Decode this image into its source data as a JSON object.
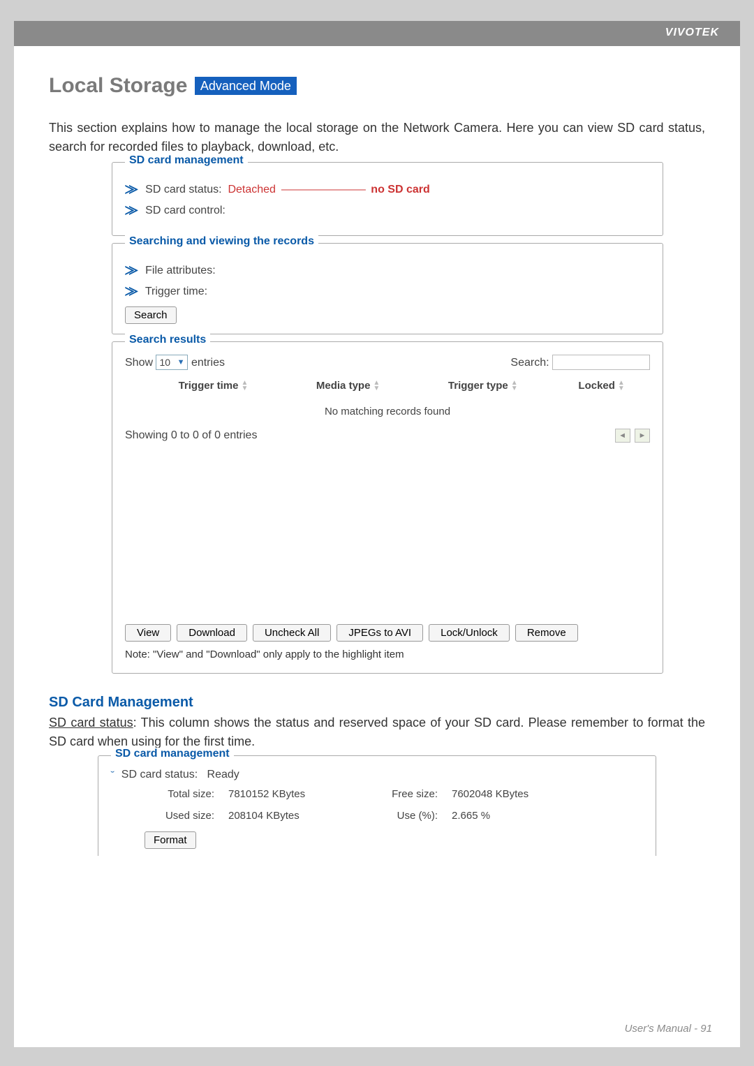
{
  "brand": "VIVOTEK",
  "page_title": "Local Storage",
  "badge": "Advanced Mode",
  "intro": "This section explains how to manage the local storage on the Network Camera. Here you can view SD card status, search for recorded files to playback, download, etc.",
  "fs1": {
    "legend": "SD card management",
    "status_label": "SD card status:",
    "status_value": "Detached",
    "line": "————————",
    "no_sd": "no SD card",
    "control_label": "SD card control:"
  },
  "fs2": {
    "legend": "Searching and viewing the records",
    "file_attr": "File attributes:",
    "trigger_time": "Trigger time:",
    "search_btn": "Search"
  },
  "fs3": {
    "legend": "Search results",
    "show": "Show",
    "entries": "entries",
    "count_option": "10",
    "search_label": "Search:",
    "columns": {
      "c1": "Trigger time",
      "c2": "Media type",
      "c3": "Trigger type",
      "c4": "Locked"
    },
    "no_match": "No matching records found",
    "showing": "Showing 0 to 0 of 0 entries",
    "actions": {
      "view": "View",
      "download": "Download",
      "uncheck": "Uncheck All",
      "jpegs": "JPEGs to AVI",
      "lock": "Lock/Unlock",
      "remove": "Remove"
    },
    "note": "Note: \"View\" and \"Download\" only apply to the highlight item"
  },
  "sd_mgmt_head": "SD Card Management",
  "sd_mgmt_underline": "SD card status",
  "sd_mgmt_text": ": This column shows the status and reserved space of your SD card. Please remember to format the SD card when using for the first time.",
  "fs4": {
    "legend": "SD card management",
    "status_label": "SD card status:",
    "status_value": "Ready",
    "total_label": "Total size:",
    "total_value": "7810152 KBytes",
    "free_label": "Free size:",
    "free_value": "7602048 KBytes",
    "used_label": "Used size:",
    "used_value": "208104 KBytes",
    "usep_label": "Use (%):",
    "usep_value": "2.665 %",
    "format_btn": "Format"
  },
  "footer": "User's Manual - 91"
}
